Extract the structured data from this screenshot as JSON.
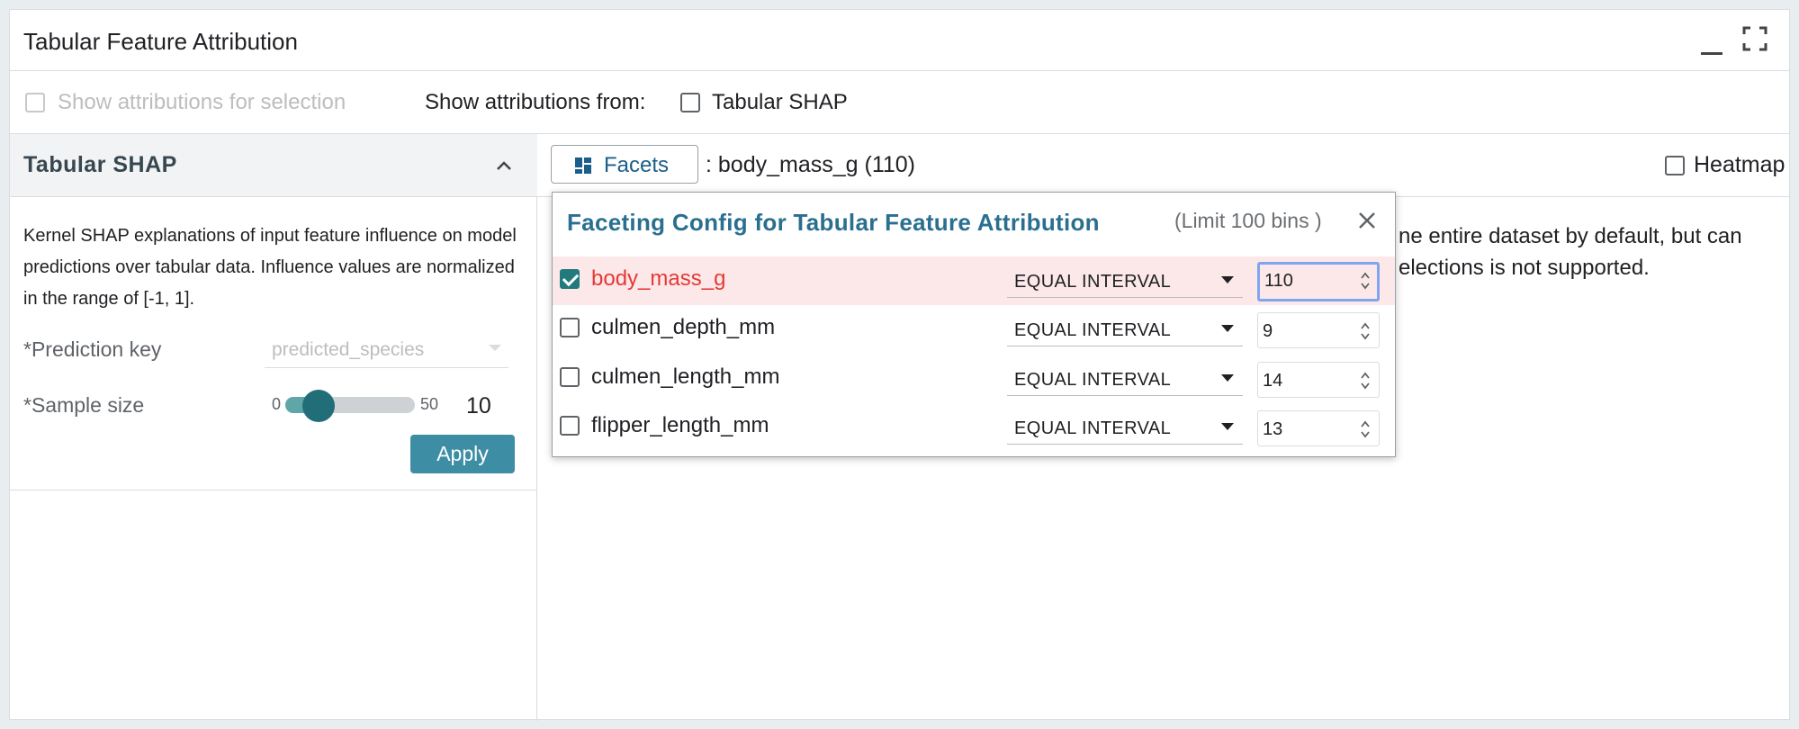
{
  "panel": {
    "title": "Tabular Feature Attribution"
  },
  "toolbar": {
    "show_selection_label": "Show attributions for selection",
    "show_from_label": "Show attributions from:",
    "source_option_label": "Tabular SHAP"
  },
  "sidebar": {
    "section_title": "Tabular SHAP",
    "description": "Kernel SHAP explanations of input feature influence on model predictions over tabular data. Influence values are normalized in the range of [-1, 1].",
    "prediction_key_label": "*Prediction key",
    "prediction_key_value": "predicted_species",
    "sample_size_label": "*Sample size",
    "slider_min": "0",
    "slider_max": "50",
    "sample_size_value": "10",
    "sample_size_fraction": 0.2,
    "apply_label": "Apply"
  },
  "main": {
    "facets_label": "Facets",
    "facet_summary": ": body_mass_g (110)",
    "heatmap_label": "Heatmap",
    "message_line1": "ne entire dataset by default, but can",
    "message_line2": "elections is not supported."
  },
  "facet_popup": {
    "title": "Faceting Config for Tabular Feature Attribution",
    "limit": "(Limit 100 bins )",
    "rows": [
      {
        "feature": "body_mass_g",
        "checked": true,
        "method": "EQUAL INTERVAL",
        "bins": "110"
      },
      {
        "feature": "culmen_depth_mm",
        "checked": false,
        "method": "EQUAL INTERVAL",
        "bins": "9"
      },
      {
        "feature": "culmen_length_mm",
        "checked": false,
        "method": "EQUAL INTERVAL",
        "bins": "14"
      },
      {
        "feature": "flipper_length_mm",
        "checked": false,
        "method": "EQUAL INTERVAL",
        "bins": "13"
      }
    ]
  },
  "colors": {
    "accent": "#227a7d",
    "apply_button": "#3d8ea4",
    "selected_row_text": "#e53935",
    "popup_title": "#2a6f8f"
  },
  "icons": [
    "minimize-icon",
    "fullscreen-icon",
    "chevron-up-icon",
    "grid-icon",
    "close-icon",
    "stepper-icon",
    "caret-down-icon"
  ]
}
